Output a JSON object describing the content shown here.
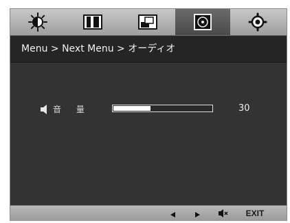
{
  "tabs": [
    {
      "icon": "brightness-contrast-icon",
      "active": false
    },
    {
      "icon": "color-bars-icon",
      "active": false
    },
    {
      "icon": "picture-icon",
      "active": false
    },
    {
      "icon": "audio-disc-icon",
      "active": true
    },
    {
      "icon": "settings-gear-icon",
      "active": false
    }
  ],
  "breadcrumb": {
    "text": "Menu > Next Menu > オーディオ"
  },
  "volume": {
    "icon": "speaker-icon",
    "label": "音 量",
    "value": "30",
    "level_percent": 30
  },
  "bottom_bar": {
    "left_icon": "left-arrow-icon",
    "right_icon": "right-arrow-icon",
    "mute_icon": "speaker-mute-icon",
    "exit_label": "EXIT"
  },
  "colors": {
    "panel_bg": "#333333",
    "tab_active": "#555555",
    "text": "#f2f2f2"
  }
}
